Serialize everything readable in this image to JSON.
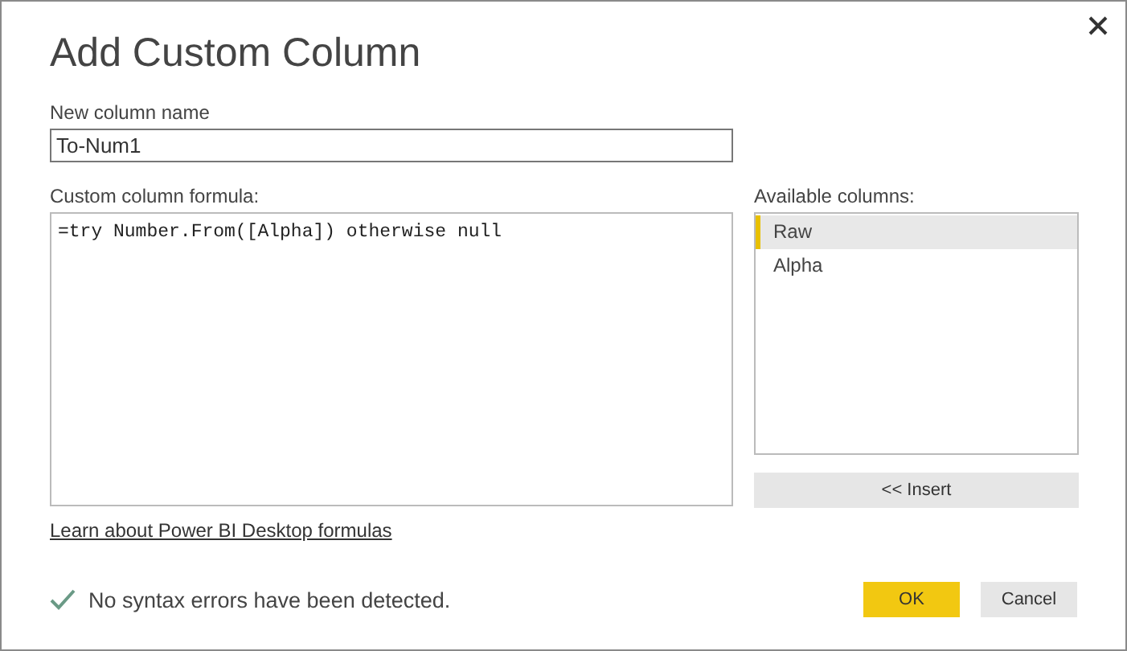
{
  "dialog": {
    "title": "Add Custom Column"
  },
  "name_field": {
    "label": "New column name",
    "value": "To-Num1"
  },
  "formula_field": {
    "label": "Custom column formula:",
    "value": "=try Number.From([Alpha]) otherwise null"
  },
  "available_columns": {
    "label": "Available columns:",
    "items": [
      {
        "label": "Raw",
        "selected": true
      },
      {
        "label": "Alpha",
        "selected": false
      }
    ],
    "insert_button": "<< Insert"
  },
  "help_link": "Learn about Power BI Desktop formulas",
  "status": {
    "kind": "ok",
    "message": "No syntax errors have been detected."
  },
  "buttons": [
    {
      "label": "OK",
      "kind": "primary"
    },
    {
      "label": "Cancel",
      "kind": "secondary"
    }
  ]
}
